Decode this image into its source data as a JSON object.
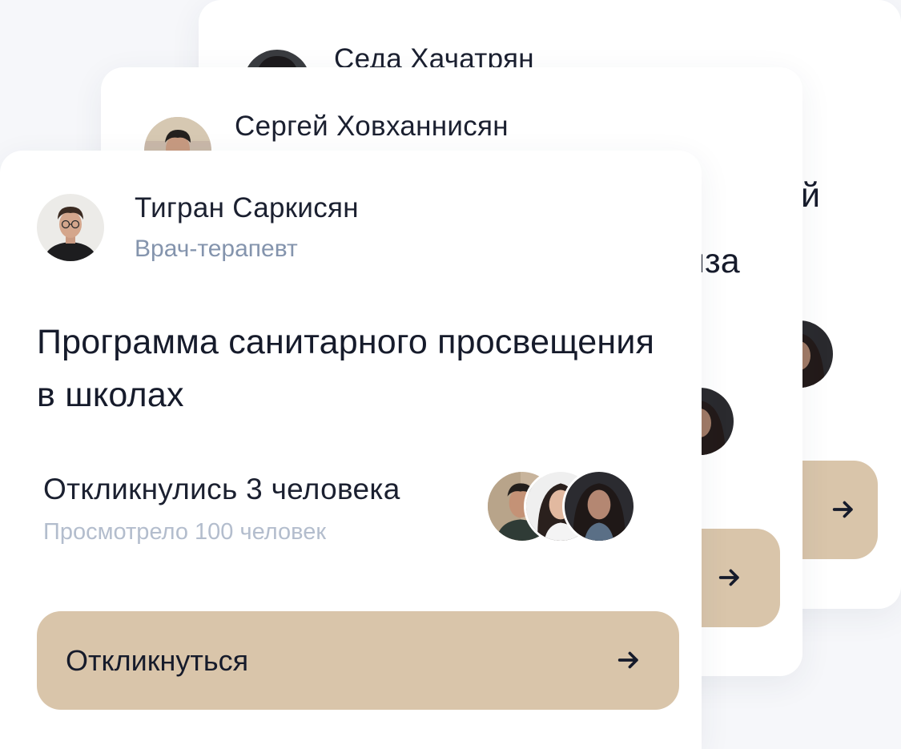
{
  "cards": {
    "back": {
      "author_name": "Седа Хачатрян",
      "title_fragment": "й"
    },
    "middle": {
      "author_name": "Сергей Ховханнисян",
      "title_fragment": "иза"
    },
    "front": {
      "author_name": "Тигран Саркисян",
      "author_role": "Врач-терапевт",
      "title_line1": "Программа санитарного просвещения",
      "title_line2": "в школах",
      "responded": "Откликнулись 3 человека",
      "views": "Просмотрело 100 человек",
      "respond_button": "Откликнуться"
    }
  },
  "icons": {
    "arrow": "arrow-right-icon"
  },
  "colors": {
    "button_bg": "#d9c5aa",
    "text_primary": "#1b2030",
    "text_secondary": "#8494ad",
    "text_muted": "#b3bdcd",
    "card_bg": "#ffffff"
  }
}
